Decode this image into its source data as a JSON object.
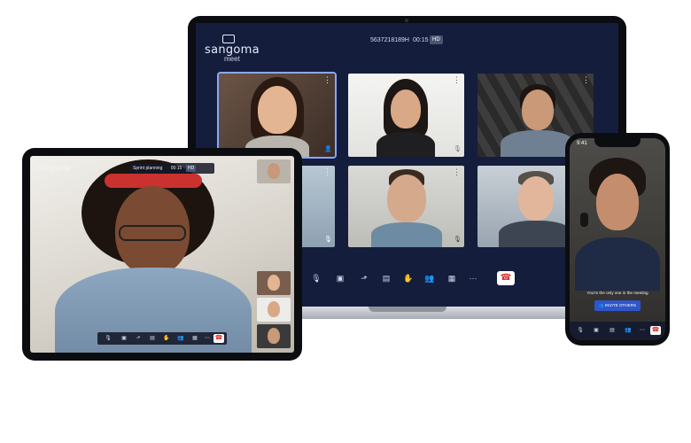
{
  "laptop": {
    "brand": "sangoma",
    "product": "meet",
    "meeting_id": "5637218189H",
    "elapsed": "00:15",
    "quality": "HD",
    "end_call_icon": "phone-hangup-icon"
  },
  "tablet": {
    "brand": "sangoma",
    "meeting_title": "Sprint planning",
    "elapsed": "00:15",
    "quality": "HD"
  },
  "phone": {
    "status_time": "9:41",
    "message": "You're the only one in the meeting",
    "invite_label": "INVITE OTHERS"
  },
  "colors": {
    "laptop_bg": "#141d3c",
    "accent": "#2f56c9",
    "hangup": "#e12a2a"
  }
}
